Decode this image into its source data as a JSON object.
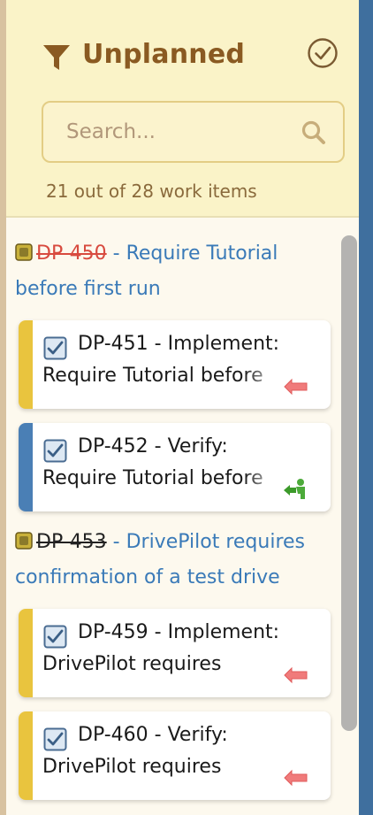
{
  "header": {
    "title": "Unplanned",
    "search_placeholder": "Search...",
    "count_text": "21 out of 28 work items"
  },
  "colors": {
    "accent_brown": "#8a5a22",
    "link_blue": "#3a7ab8",
    "bar_yellow": "#e9c43e",
    "bar_blue": "#4a7fb5",
    "strike_red": "#d84b3f"
  },
  "groups": [
    {
      "id": "DP-450",
      "id_style": "red-strike",
      "title_line1": " - Require Tutorial",
      "title_line2": "before first run",
      "items": [
        {
          "line1": "DP-451 - Implement:",
          "line2": "Require Tutorial before",
          "bar": "yellow",
          "status_icon": "red-arrow-left-icon"
        },
        {
          "line1": "DP-452 - Verify:",
          "line2": "Require Tutorial before",
          "bar": "blue",
          "status_icon": "green-person-enter-icon"
        }
      ]
    },
    {
      "id": "DP-453",
      "id_style": "black-strike",
      "title_line1": " - DrivePilot requires",
      "title_line2": "confirmation of a test drive",
      "items": [
        {
          "line1": "DP-459 - Implement:",
          "line2": "DrivePilot requires",
          "bar": "yellow",
          "status_icon": "red-arrow-left-icon"
        },
        {
          "line1": "DP-460 - Verify:",
          "line2": "DrivePilot requires",
          "bar": "yellow",
          "status_icon": "red-arrow-left-icon"
        }
      ]
    }
  ]
}
